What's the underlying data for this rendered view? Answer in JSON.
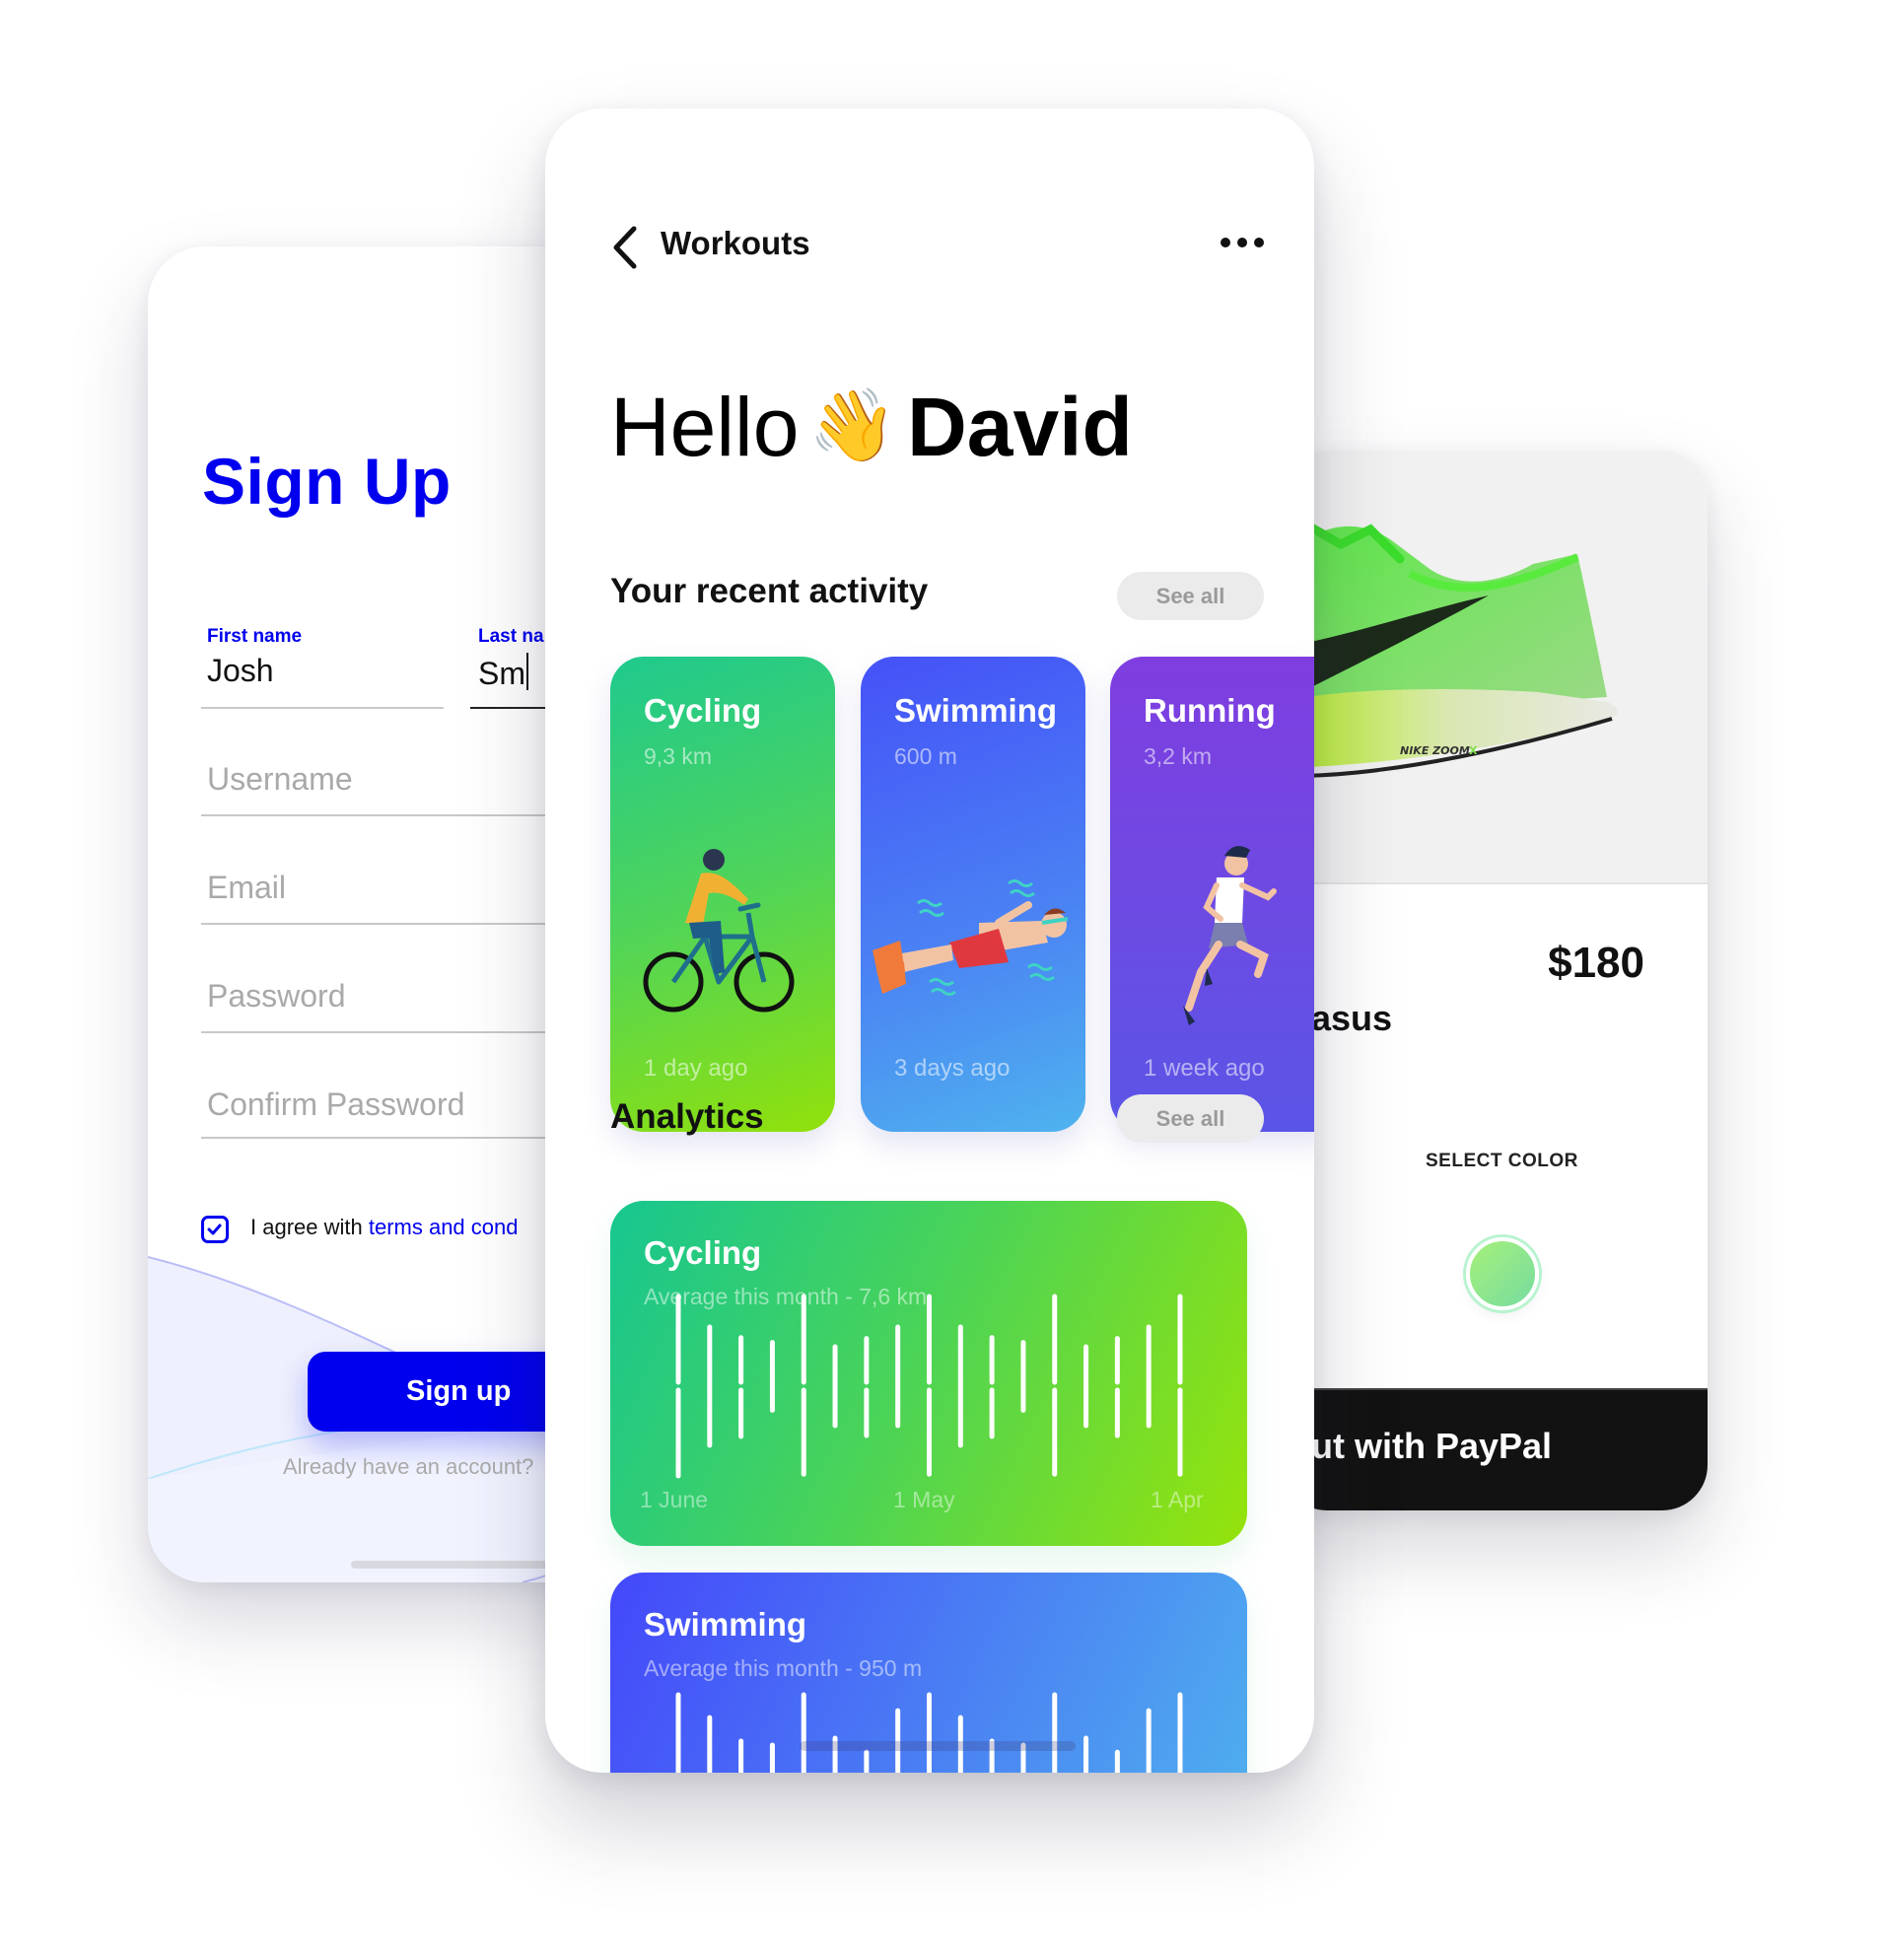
{
  "signup": {
    "title": "Sign Up",
    "first_name_label": "First name",
    "first_name_value": "Josh",
    "last_name_label": "Last na",
    "last_name_value": "Sm",
    "username_placeholder": "Username",
    "email_placeholder": "Email",
    "password_placeholder": "Password",
    "confirm_password_placeholder": "Confirm Password",
    "agree_text": "I agree with ",
    "agree_link": "terms and cond",
    "agree_checked": true,
    "signup_button": "Sign up",
    "already_text": "Already have an account?",
    "accent_color": "#0000ee"
  },
  "workouts": {
    "nav_title": "Workouts",
    "greeting": "Hello",
    "wave_emoji": "👋",
    "user_name": "David",
    "recent_title": "Your recent activity",
    "recent_see_all": "See all",
    "activities": [
      {
        "name": "Cycling",
        "distance": "9,3 km",
        "when": "1 day ago",
        "icon": "cyclist-illustration"
      },
      {
        "name": "Swimming",
        "distance": "600 m",
        "when": "3 days ago",
        "icon": "swimmer-illustration"
      },
      {
        "name": "Running",
        "distance": "3,2 km",
        "when": "1 week ago",
        "icon": "runner-illustration"
      }
    ],
    "analytics_title": "Analytics",
    "analytics_see_all": "See all",
    "analytics": [
      {
        "name": "Cycling",
        "subtitle": "Average this month - 7,6 km",
        "x_labels": [
          "1 June",
          "1 May",
          "1 Apr"
        ]
      },
      {
        "name": "Swimming",
        "subtitle": "Average this month - 950 m"
      }
    ]
  },
  "product": {
    "price": "$180",
    "name_fragment": "asus",
    "select_color_label": "SELECT COLOR",
    "selected_color": "#8fe68a",
    "checkout_button": "ut with PayPal"
  },
  "chart_data": [
    {
      "type": "bar",
      "title": "Cycling",
      "subtitle": "Average this month - 7,6 km",
      "note": "Decorative waveform bars; each bar split into upper/lower segments. Values are relative heights (0-1) of each segment.",
      "x_tick_labels": [
        "1 June",
        "1 May",
        "1 Apr"
      ],
      "bar_count": 17,
      "series": [
        {
          "name": "upper",
          "values": [
            1.0,
            0.0,
            0.52,
            0.0,
            1.0,
            0.0,
            0.51,
            0.0,
            1.0,
            0.0,
            0.52,
            0.0,
            1.0,
            0.0,
            0.51,
            0.0,
            1.0
          ]
        },
        {
          "name": "lower",
          "values": [
            1.0,
            0.0,
            0.54,
            0.0,
            0.98,
            0.0,
            0.53,
            0.0,
            0.98,
            0.0,
            0.54,
            0.0,
            0.98,
            0.0,
            0.53,
            0.0,
            0.98
          ]
        },
        {
          "name": "single",
          "values": [
            0.0,
            1.38,
            0.0,
            0.79,
            0.0,
            0.92,
            0.0,
            1.15,
            0.0,
            1.38,
            0.0,
            0.79,
            0.0,
            0.92,
            0.0,
            1.15,
            0.0
          ]
        }
      ]
    },
    {
      "type": "bar",
      "title": "Swimming",
      "subtitle": "Average this month - 950 m",
      "note": "Partially visible (clipped by screen bottom); relative heights of upper segments.",
      "bar_count": 17,
      "series": [
        {
          "name": "upper",
          "values": [
            1.0,
            0.0,
            0.46,
            0.0,
            1.0,
            0.0,
            0.33,
            0.0,
            1.0,
            0.0,
            0.46,
            0.0,
            1.0,
            0.0,
            0.33,
            0.0,
            1.0
          ]
        },
        {
          "name": "single_top",
          "values": [
            0.0,
            0.78,
            0.0,
            0.46,
            0.0,
            0.54,
            0.0,
            0.86,
            0.0,
            0.78,
            0.0,
            0.46,
            0.0,
            0.54,
            0.0,
            0.86,
            0.0
          ]
        }
      ]
    }
  ]
}
